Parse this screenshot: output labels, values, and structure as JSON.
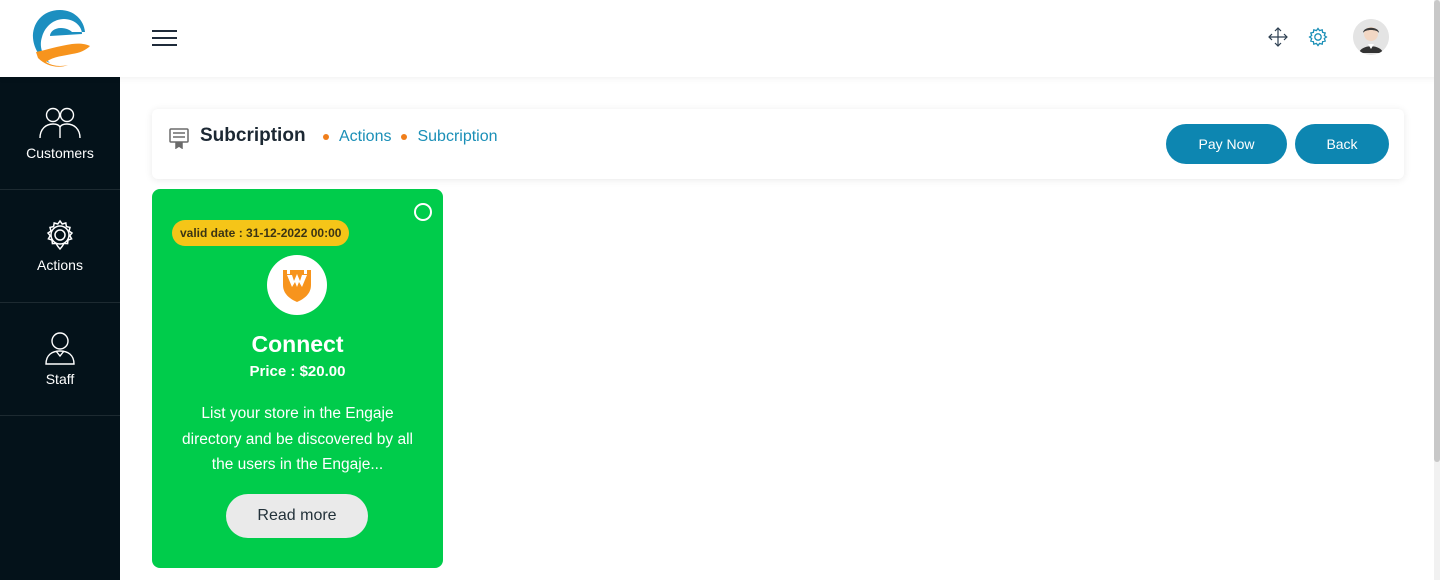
{
  "header": {
    "logo_icon": "engaje-logo-icon",
    "menu_icon": "hamburger-menu-icon",
    "fullscreen_icon": "fullscreen-arrows-icon",
    "settings_icon": "gear-icon",
    "avatar_icon": "user-avatar-icon"
  },
  "sidebar": {
    "items": [
      {
        "label": "Customers",
        "icon": "users-icon"
      },
      {
        "label": "Actions",
        "icon": "gear-icon"
      },
      {
        "label": "Staff",
        "icon": "user-icon"
      }
    ]
  },
  "page": {
    "title": "Subcription",
    "breadcrumb": [
      "Actions",
      "Subcription"
    ],
    "pay_button": "Pay Now",
    "back_button": "Back"
  },
  "plan": {
    "valid_date": "valid date : 31-12-2022 00:00",
    "name": "Connect",
    "price": "Price : $20.00",
    "description": "List your store in the Engaje directory and be discovered by all the users in the Engaje...",
    "read_more": "Read more",
    "selected": false
  },
  "colors": {
    "accent": "#0d86b1",
    "sidebar_bg": "#04121a",
    "card_bg": "#00cc4b",
    "badge_bg": "#f5c518",
    "breadcrumb_dot": "#f07e1b",
    "logo_orange": "#f7941d",
    "logo_blue": "#1c8fc0"
  }
}
